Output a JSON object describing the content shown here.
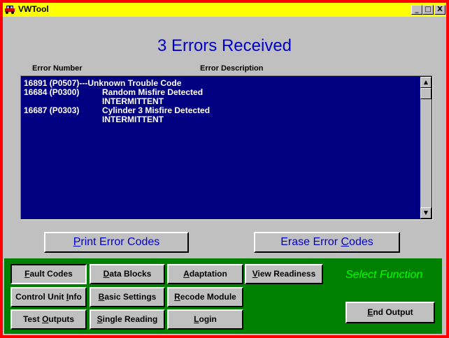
{
  "window": {
    "title": "VWTool"
  },
  "titlebar_buttons": {
    "minimize": "_",
    "maximize": "□",
    "close": "X"
  },
  "header": {
    "title": "3 Errors Received"
  },
  "list": {
    "col_error_number": "Error Number",
    "col_error_description": "Error Description",
    "rows": [
      {
        "number": "16891 (P0507)",
        "description": "---Unknown Trouble Code"
      },
      {
        "number": "16684 (P0300)",
        "description": "Random Misfire Detected"
      },
      {
        "number": "",
        "description": "INTERMITTENT"
      },
      {
        "number": "16687 (P0303)",
        "description": "Cylinder 3 Misfire Detected"
      },
      {
        "number": "",
        "description": "INTERMITTENT"
      }
    ]
  },
  "actions": {
    "print_pre": "",
    "print_key": "P",
    "print_post": "rint Error Codes",
    "erase_pre": "Erase Error ",
    "erase_key": "C",
    "erase_post": "odes"
  },
  "functions": {
    "fault_codes": {
      "pre": "",
      "key": "F",
      "post": "ault Codes"
    },
    "data_blocks": {
      "pre": "",
      "key": "D",
      "post": "ata Blocks"
    },
    "adaptation": {
      "pre": "",
      "key": "A",
      "post": "daptation"
    },
    "view_readiness": {
      "pre": "",
      "key": "V",
      "post": "iew Readiness"
    },
    "control_unit_info": {
      "pre": "Control Unit ",
      "key": "I",
      "post": "nfo"
    },
    "basic_settings": {
      "pre": "",
      "key": "B",
      "post": "asic Settings"
    },
    "recode_module": {
      "pre": "",
      "key": "R",
      "post": "ecode Module"
    },
    "test_outputs": {
      "pre": "Test ",
      "key": "O",
      "post": "utputs"
    },
    "single_reading": {
      "pre": "",
      "key": "S",
      "post": "ingle Reading"
    },
    "login": {
      "pre": "",
      "key": "L",
      "post": "ogin"
    },
    "end_output": {
      "pre": "",
      "key": "E",
      "post": "nd Output"
    }
  },
  "status": {
    "select_function": "Select Function"
  },
  "colors": {
    "title_bar": "#ffff00",
    "frame": "#ff0000",
    "list_bg": "#000080",
    "panel": "#008000",
    "accent": "#0000cc",
    "status": "#00ff00"
  }
}
